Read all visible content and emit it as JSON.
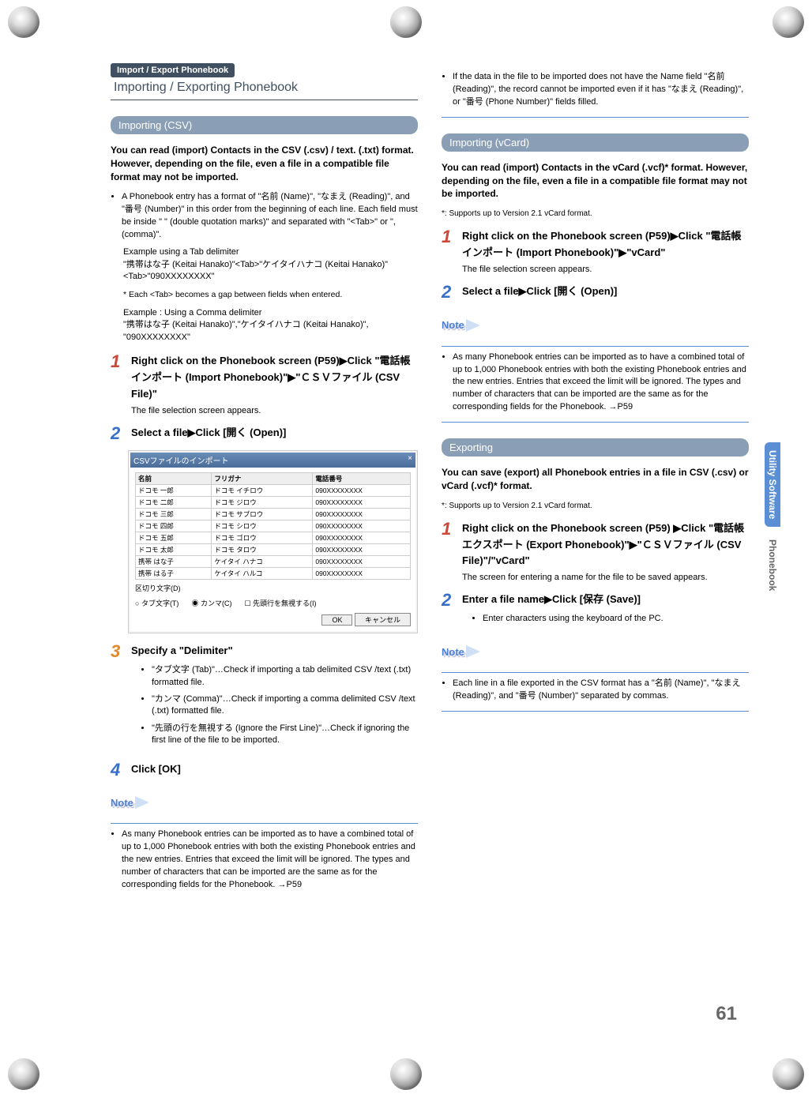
{
  "header": {
    "badge": "Import / Export Phonebook",
    "title": "Importing / Exporting Phonebook"
  },
  "sidebar": {
    "tab1": "Utility Software",
    "tab2": "Phonebook"
  },
  "page_number": "61",
  "csv": {
    "heading": "Importing (CSV)",
    "intro": "You can read (import) Contacts in the CSV (.csv) / text. (.txt) format. However, depending on the file, even a file in a compatible file format may not be imported.",
    "bullet1": "A Phonebook entry has a format of \"名前 (Name)\", \"なまえ (Reading)\", and \"番号 (Number)\" in this order from the beginning of each line. Each field must be inside \" \" (double quotation marks)\" and separated with \"<Tab>\" or \", (comma)\".",
    "ex_tab_title": "Example using a Tab delimiter",
    "ex_tab": "\"携帯はな子 (Keitai Hanako)\"<Tab>\"ケイタイハナコ (Keitai Hanako)\"<Tab>\"090XXXXXXXX\"",
    "ex_tab_star": "* Each <Tab> becomes a gap between fields when entered.",
    "ex_comma_title": "Example : Using a Comma delimiter",
    "ex_comma": "\"携帯はな子 (Keitai Hanako)\",\"ケイタイハナコ (Keitai Hanako)\", \"090XXXXXXXX\"",
    "step1": "Right click on the Phonebook screen (P59)▶Click \"電話帳インポート (Import Phonebook)\"▶\"ＣＳＶファイル (CSV File)\"",
    "step1_desc": "The file selection screen appears.",
    "step2": "Select a file▶Click [開く (Open)]",
    "step3": "Specify a \"Delimiter\"",
    "step3_b1": "\"タブ文字 (Tab)\"…Check if importing a tab delimited CSV /text (.txt) formatted file.",
    "step3_b2": "\"カンマ (Comma)\"…Check if importing a comma delimited CSV /text (.txt) formatted file.",
    "step3_b3": "\"先頭の行を無視する (Ignore the First Line)\"…Check if ignoring the first line of the file to be imported.",
    "step4": "Click [OK]",
    "note_label": "Note",
    "note1": "As many Phonebook entries can be imported as to have a combined total of up to 1,000 Phonebook entries with both the existing Phonebook entries and the new entries. Entries that exceed the limit will be ignored. The types and number of characters that can be imported are the same as for the corresponding fields for the Phonebook. →P59",
    "note2": "If the data in the file to be imported does not have the Name field \"名前 (Reading)\", the record cannot be imported even if it has \"なまえ (Reading)\", or \"番号 (Phone Number)\" fields filled."
  },
  "vcard": {
    "heading": "Importing (vCard)",
    "intro": "You can read (import) Contacts in the vCard (.vcf)* format. However, depending on the file, even a file in a compatible file format may not be imported.",
    "footnote": "*: Supports up to Version 2.1 vCard format.",
    "step1": "Right click on the Phonebook screen (P59)▶Click \"電話帳インポート (Import Phonebook)\"▶\"vCard\"",
    "step1_desc": "The file selection screen appears.",
    "step2": "Select a file▶Click [開く (Open)]",
    "note_label": "Note",
    "note1": "As many Phonebook entries can be imported as to have a combined total of up to 1,000 Phonebook entries with both the existing Phonebook entries and the new entries. Entries that exceed the limit will be ignored. The types and number of characters that can be imported are the same as for the corresponding fields for the Phonebook. →P59"
  },
  "exporting": {
    "heading": "Exporting",
    "intro": "You can save (export) all Phonebook entries in a file in CSV (.csv) or vCard (.vcf)* format.",
    "footnote": "*: Supports up to Version 2.1 vCard format.",
    "step1": "Right click on the Phonebook screen (P59) ▶Click \"電話帳エクスポート (Export Phonebook)\"▶\"ＣＳＶファイル (CSV File)\"/\"vCard\"",
    "step1_desc": "The screen for entering a name for the file to be saved appears.",
    "step2": "Enter a file name▶Click [保存 (Save)]",
    "step2_b1": "Enter characters using the keyboard of the PC.",
    "note_label": "Note",
    "note1": "Each line in a file exported in the CSV format has a \"名前 (Name)\", \"なまえ (Reading)\", and \"番号 (Number)\" separated by commas."
  },
  "dialog": {
    "title": "CSVファイルのインポート",
    "close": "×",
    "col_name": "名前",
    "col_reading": "フリガナ",
    "col_number": "電話番号",
    "rows": [
      {
        "n": "ドコモ 一郎",
        "r": "ドコモ イチロウ",
        "p": "090XXXXXXXX"
      },
      {
        "n": "ドコモ 二郎",
        "r": "ドコモ ジロウ",
        "p": "090XXXXXXXX"
      },
      {
        "n": "ドコモ 三郎",
        "r": "ドコモ サブロウ",
        "p": "090XXXXXXXX"
      },
      {
        "n": "ドコモ 四郎",
        "r": "ドコモ シロウ",
        "p": "090XXXXXXXX"
      },
      {
        "n": "ドコモ 五郎",
        "r": "ドコモ ゴロウ",
        "p": "090XXXXXXXX"
      },
      {
        "n": "ドコモ 太郎",
        "r": "ドコモ タロウ",
        "p": "090XXXXXXXX"
      },
      {
        "n": "携帯 はな子",
        "r": "ケイタイ ハナコ",
        "p": "090XXXXXXXX"
      },
      {
        "n": "携帯 はる子",
        "r": "ケイタイ ハルコ",
        "p": "090XXXXXXXX"
      }
    ],
    "delimiter_label": "区切り文字(D)",
    "radio_tab": "タブ文字(T)",
    "radio_comma": "カンマ(C)",
    "check_ignore": "先頭行を無視する(I)",
    "btn_ok": "OK",
    "btn_cancel": "キャンセル"
  }
}
